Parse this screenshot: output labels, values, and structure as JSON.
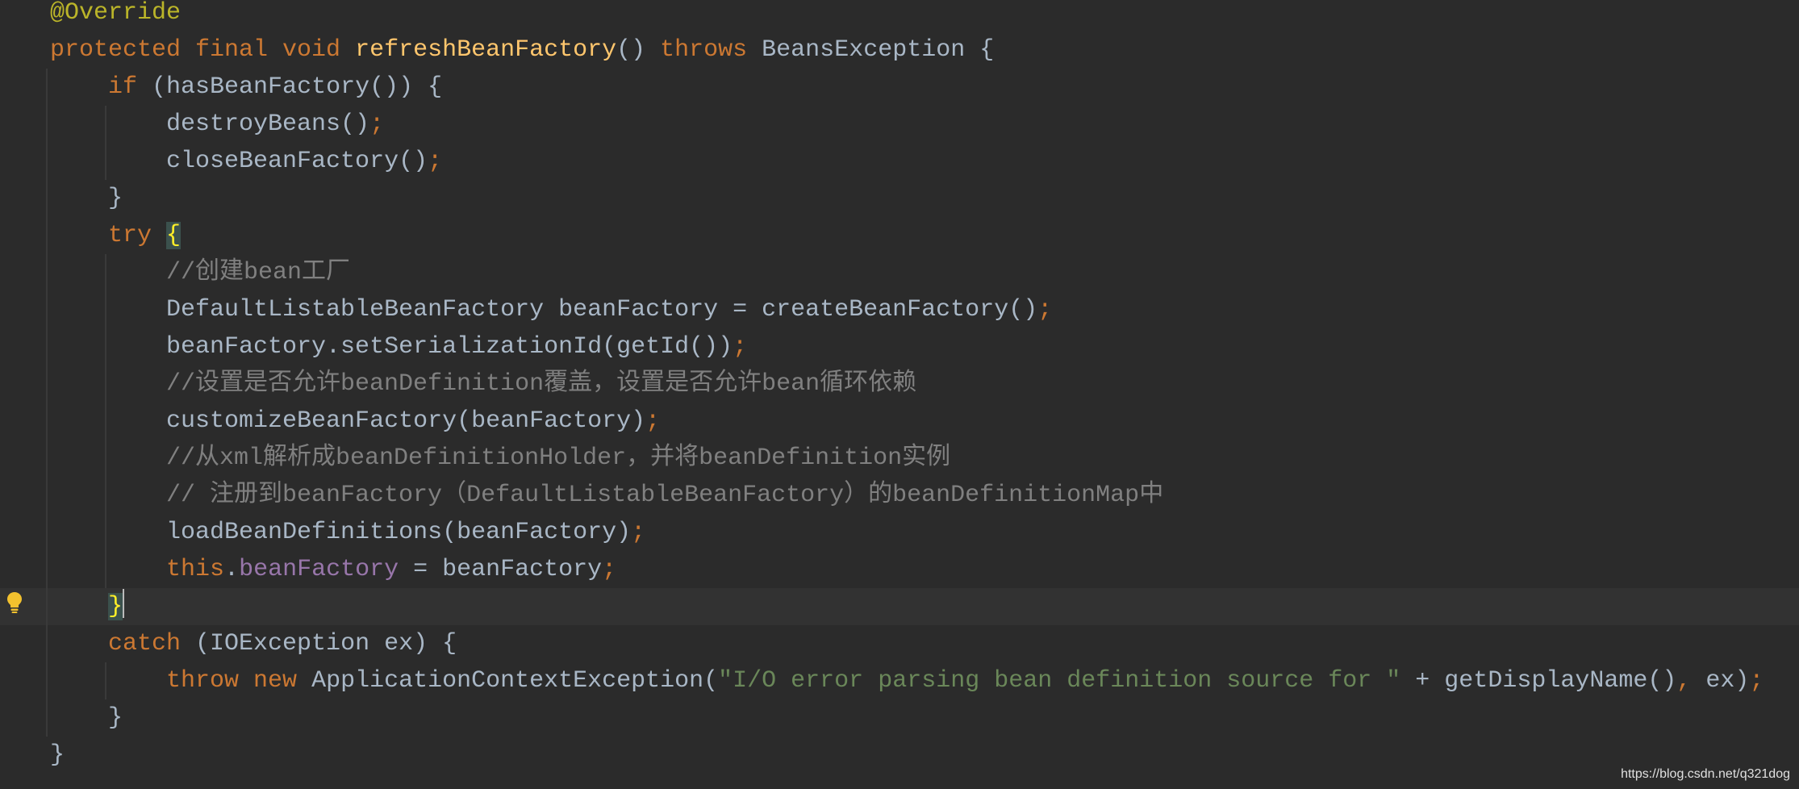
{
  "editor": {
    "colors": {
      "background": "#2B2B2B",
      "current_line": "#323232",
      "plain": "#A9B7C6",
      "keyword": "#CC7832",
      "annotation": "#BBB529",
      "method_decl": "#FFC66D",
      "string": "#6A8759",
      "comment": "#808080",
      "field": "#9876AA",
      "brace_match_fg": "#FFEF28",
      "brace_match_bg": "#3B514D",
      "indent_guide": "#3A3A3A",
      "caret": "#BBBBBB",
      "intention_bulb": "#F2C12E",
      "watermark": "#E0E0E0"
    },
    "lines": [
      {
        "tokens": [
          {
            "text": "@Override",
            "kind": "annotation"
          }
        ]
      },
      {
        "tokens": [
          {
            "text": "protected final void ",
            "kind": "keyword"
          },
          {
            "text": "refreshBeanFactory",
            "kind": "method_decl"
          },
          {
            "text": "() ",
            "kind": "plain"
          },
          {
            "text": "throws",
            "kind": "keyword"
          },
          {
            "text": " BeansException {",
            "kind": "plain"
          }
        ]
      },
      {
        "tokens": [
          {
            "text": "    if",
            "kind": "keyword"
          },
          {
            "text": " (hasBeanFactory()) {",
            "kind": "plain"
          }
        ]
      },
      {
        "tokens": [
          {
            "text": "        destroyBeans()",
            "kind": "plain"
          },
          {
            "text": ";",
            "kind": "keyword"
          }
        ]
      },
      {
        "tokens": [
          {
            "text": "        closeBeanFactory()",
            "kind": "plain"
          },
          {
            "text": ";",
            "kind": "keyword"
          }
        ]
      },
      {
        "tokens": [
          {
            "text": "    }",
            "kind": "plain"
          }
        ]
      },
      {
        "tokens": [
          {
            "text": "    try ",
            "kind": "keyword"
          },
          {
            "text": "{",
            "kind": "brace_match"
          }
        ]
      },
      {
        "tokens": [
          {
            "text": "        //创建bean工厂",
            "kind": "comment"
          }
        ]
      },
      {
        "tokens": [
          {
            "text": "        DefaultListableBeanFactory beanFactory = createBeanFactory()",
            "kind": "plain"
          },
          {
            "text": ";",
            "kind": "keyword"
          }
        ]
      },
      {
        "tokens": [
          {
            "text": "        beanFactory.setSerializationId(getId())",
            "kind": "plain"
          },
          {
            "text": ";",
            "kind": "keyword"
          }
        ]
      },
      {
        "tokens": [
          {
            "text": "        //设置是否允许beanDefinition覆盖，设置是否允许bean循环依赖",
            "kind": "comment"
          }
        ]
      },
      {
        "tokens": [
          {
            "text": "        customizeBeanFactory(beanFactory)",
            "kind": "plain"
          },
          {
            "text": ";",
            "kind": "keyword"
          }
        ]
      },
      {
        "tokens": [
          {
            "text": "        //从xml解析成beanDefinitionHolder，并将beanDefinition实例",
            "kind": "comment"
          }
        ]
      },
      {
        "tokens": [
          {
            "text": "        // 注册到beanFactory（DefaultListableBeanFactory）的beanDefinitionMap中",
            "kind": "comment"
          }
        ]
      },
      {
        "tokens": [
          {
            "text": "        loadBeanDefinitions(beanFactory)",
            "kind": "plain"
          },
          {
            "text": ";",
            "kind": "keyword"
          }
        ]
      },
      {
        "tokens": [
          {
            "text": "        this",
            "kind": "keyword"
          },
          {
            "text": ".",
            "kind": "plain"
          },
          {
            "text": "beanFactory",
            "kind": "field"
          },
          {
            "text": " = beanFactory",
            "kind": "plain"
          },
          {
            "text": ";",
            "kind": "keyword"
          }
        ]
      },
      {
        "current": true,
        "gutter_icon": "intention-bulb-icon",
        "tokens": [
          {
            "text": "    ",
            "kind": "plain"
          },
          {
            "text": "}",
            "kind": "brace_match"
          }
        ]
      },
      {
        "tokens": [
          {
            "text": "    catch",
            "kind": "keyword"
          },
          {
            "text": " (IOException ex) {",
            "kind": "plain"
          }
        ]
      },
      {
        "tokens": [
          {
            "text": "        throw new ",
            "kind": "keyword"
          },
          {
            "text": "ApplicationContextException(",
            "kind": "plain"
          },
          {
            "text": "\"I/O error parsing bean definition source for \"",
            "kind": "string"
          },
          {
            "text": " + getDisplayName()",
            "kind": "plain"
          },
          {
            "text": ",",
            "kind": "keyword"
          },
          {
            "text": " ex)",
            "kind": "plain"
          },
          {
            "text": ";",
            "kind": "keyword"
          }
        ]
      },
      {
        "tokens": [
          {
            "text": "    }",
            "kind": "plain"
          }
        ]
      },
      {
        "tokens": [
          {
            "text": "}",
            "kind": "plain"
          }
        ]
      }
    ]
  },
  "watermark": "https://blog.csdn.net/q321dog"
}
